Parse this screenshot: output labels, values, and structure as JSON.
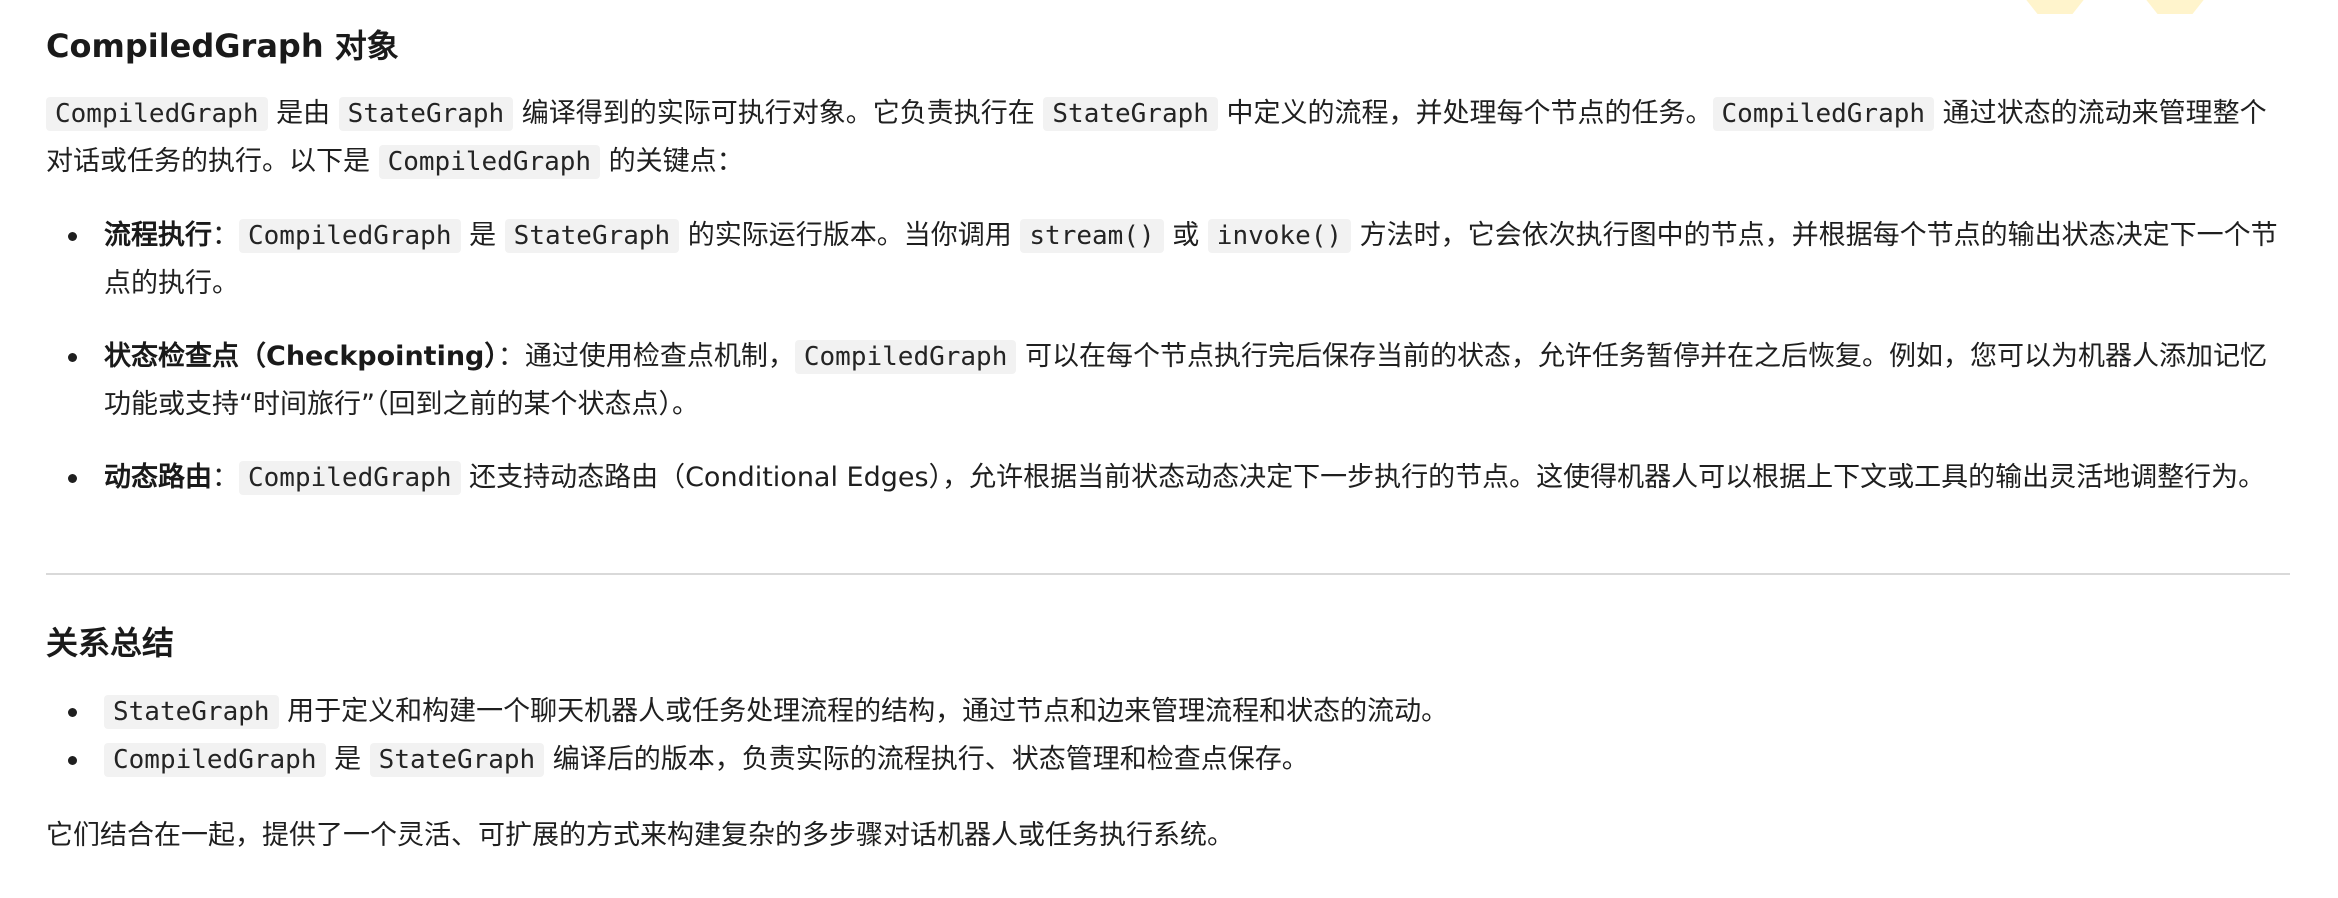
{
  "compiled_section": {
    "title": "CompiledGraph 对象",
    "intro": {
      "c1": "CompiledGraph",
      "t1": " 是由 ",
      "c2": "StateGraph",
      "t2": " 编译得到的实际可执行对象。它负责执行在 ",
      "c3": "StateGraph",
      "t3": " 中定义的流程，并处理每个节点的任务。",
      "c4": "CompiledGraph",
      "t4": " 通过状态的流动来管理整个对话或任务的执行。以下是 ",
      "c5": "CompiledGraph",
      "t5": " 的关键点："
    },
    "items": [
      {
        "label": "流程执行",
        "t0": "：",
        "c1": "CompiledGraph",
        "t1": " 是 ",
        "c2": "StateGraph",
        "t2": " 的实际运行版本。当你调用 ",
        "c3": "stream()",
        "t3": " 或 ",
        "c4": "invoke()",
        "t4": " 方法时，它会依次执行图中的节点，并根据每个节点的输出状态决定下一个节点的执行。"
      },
      {
        "label": "状态检查点（Checkpointing）",
        "t0": "：通过使用检查点机制，",
        "c1": "CompiledGraph",
        "t1": " 可以在每个节点执行完后保存当前的状态，允许任务暂停并在之后恢复。例如，您可以为机器人添加记忆功能或支持“时间旅行”（回到之前的某个状态点）。"
      },
      {
        "label": "动态路由",
        "t0": "：",
        "c1": "CompiledGraph",
        "t1": " 还支持动态路由（Conditional Edges），允许根据当前状态动态决定下一步执行的节点。这使得机器人可以根据上下文或工具的输出灵活地调整行为。"
      }
    ]
  },
  "summary_section": {
    "title": "关系总结",
    "items": [
      {
        "c1": "StateGraph",
        "t1": " 用于定义和构建一个聊天机器人或任务处理流程的结构，通过节点和边来管理流程和状态的流动。"
      },
      {
        "c1": "CompiledGraph",
        "t1": " 是 ",
        "c2": "StateGraph",
        "t2": " 编译后的版本，负责实际的流程执行、状态管理和检查点保存。"
      }
    ],
    "closing": "它们结合在一起，提供了一个灵活、可扩展的方式来构建复杂的多步骤对话机器人或任务执行系统。"
  }
}
